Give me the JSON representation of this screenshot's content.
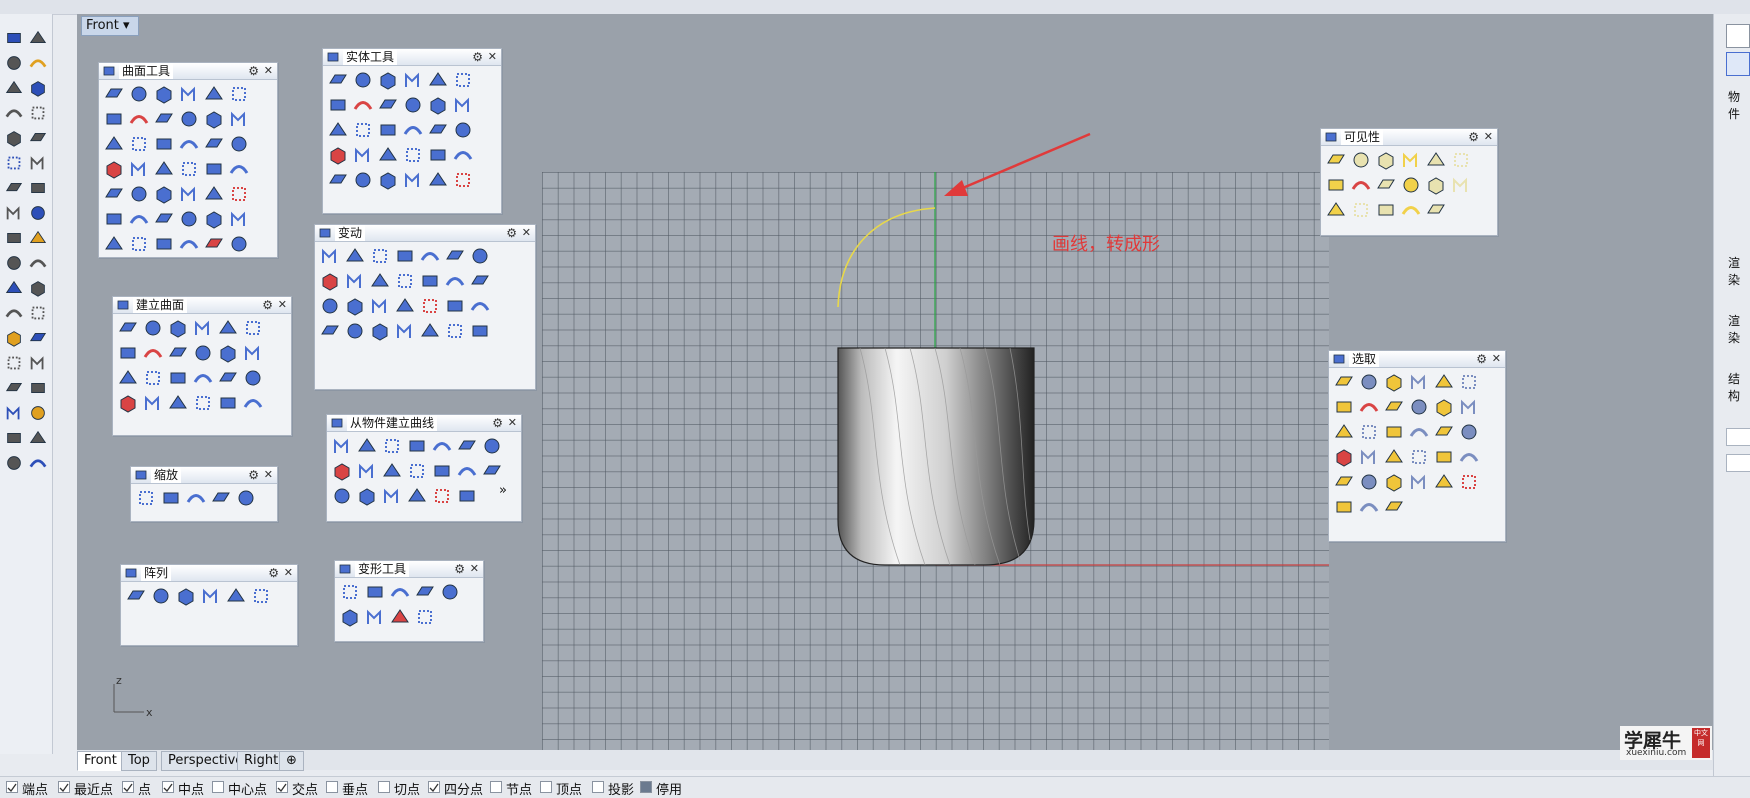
{
  "viewport": {
    "title": "Front",
    "title_arrow": "▾",
    "annotation_text": "画线，转成形"
  },
  "panels": {
    "surface_tools": {
      "title": "曲面工具"
    },
    "solid_tools": {
      "title": "实体工具"
    },
    "transform": {
      "title": "变动"
    },
    "create_surface": {
      "title": "建立曲面"
    },
    "curve_from_object": {
      "title": "从物件建立曲线",
      "more": "»"
    },
    "scale": {
      "title": "缩放"
    },
    "array": {
      "title": "阵列"
    },
    "deform_tools": {
      "title": "变形工具"
    },
    "visibility": {
      "title": "可见性"
    },
    "select": {
      "title": "选取"
    }
  },
  "axis": {
    "z": "z",
    "x": "x"
  },
  "tabs": [
    {
      "label": "Front",
      "active": true
    },
    {
      "label": "Top",
      "active": false
    },
    {
      "label": "Perspective",
      "active": false
    },
    {
      "label": "Right",
      "active": false
    },
    {
      "label": "⊕",
      "active": false
    }
  ],
  "osnap": [
    {
      "label": "端点",
      "checked": true
    },
    {
      "label": "最近点",
      "checked": true
    },
    {
      "label": "点",
      "checked": true
    },
    {
      "label": "中点",
      "checked": true
    },
    {
      "label": "中心点",
      "checked": false
    },
    {
      "label": "交点",
      "checked": true
    },
    {
      "label": "垂点",
      "checked": false
    },
    {
      "label": "切点",
      "checked": false
    },
    {
      "label": "四分点",
      "checked": true
    },
    {
      "label": "节点",
      "checked": false
    },
    {
      "label": "顶点",
      "checked": false
    },
    {
      "label": "投影",
      "checked": false
    },
    {
      "label": "停用",
      "checked": false
    }
  ],
  "right_panel": {
    "items": [
      "物件",
      "渲染",
      "渲染",
      "结构"
    ]
  },
  "logo": {
    "main": "学犀牛",
    "sub": "xuexiniu.com",
    "badge": "中文网"
  },
  "colors": {
    "grid_bg": "#a4abb4",
    "viewport_bg": "#9aa1aa",
    "curve": "#e8d84a",
    "y_axis": "#2aa845",
    "x_axis": "#c94040",
    "annotation": "#e03a3a",
    "icon_blue": "#4a6fd0"
  }
}
